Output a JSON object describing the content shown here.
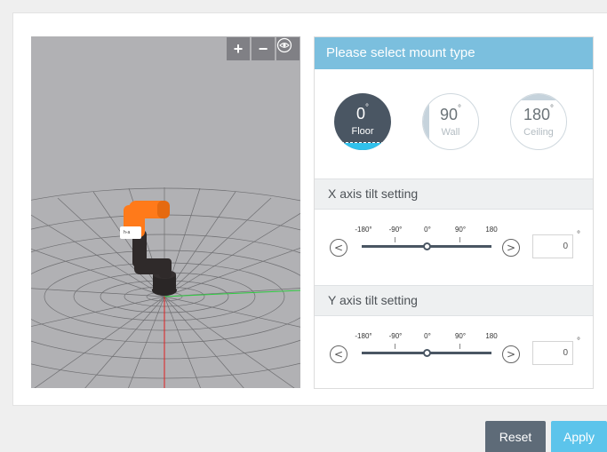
{
  "viewport": {
    "zoom_in_label": "+",
    "zoom_out_label": "−",
    "view_icon": "eye-icon",
    "robot_label": "h-a"
  },
  "panel": {
    "header": "Please select mount type",
    "mounts": [
      {
        "degree": "0",
        "label": "Floor",
        "selected": true
      },
      {
        "degree": "90",
        "label": "Wall",
        "selected": false
      },
      {
        "degree": "180",
        "label": "Ceiling",
        "selected": false
      }
    ],
    "x_axis": {
      "title": "X axis tilt setting",
      "ticks": [
        "-180",
        "-90",
        "0",
        "90",
        "180"
      ],
      "value": "0"
    },
    "y_axis": {
      "title": "Y axis tilt setting",
      "ticks": [
        "-180",
        "-90",
        "0",
        "90",
        "180"
      ],
      "value": "0"
    },
    "degree_symbol": "°"
  },
  "buttons": {
    "reset": "Reset",
    "apply": "Apply"
  },
  "colors": {
    "header": "#7bbfde",
    "selected_mount": "#4a5663",
    "selected_accent": "#30c1ec",
    "reset_button": "#5e6b78",
    "apply_button": "#5cc4eb",
    "robot_orange": "#ff7a1a"
  }
}
